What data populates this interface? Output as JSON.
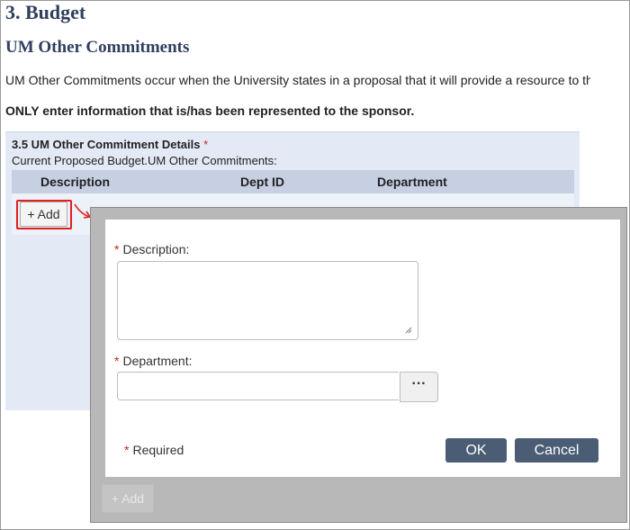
{
  "page": {
    "section_title": "3. Budget",
    "subsection_title": "UM Other Commitments",
    "intro_text": "UM Other Commitments occur when the University states in a proposal that it will provide a resource to th",
    "note_bold": "ONLY enter information that is/has been represented to the sponsor."
  },
  "panel": {
    "title": "3.5 UM Other Commitment Details",
    "required_mark": "*",
    "subtitle": "Current Proposed Budget.UM Other Commitments:",
    "columns": [
      "Description",
      "Dept ID",
      "Department"
    ],
    "add_label": "+ Add"
  },
  "dialog": {
    "description_label": "Description:",
    "department_label": "Department:",
    "required_mark": "*",
    "browse_label": "···",
    "required_note": "Required",
    "ok_label": "OK",
    "cancel_label": "Cancel",
    "description_value": "",
    "department_value": ""
  },
  "modal": {
    "bottom_add_label": "+ Add"
  },
  "colors": {
    "heading": "#2f3f5f",
    "panel_bg": "#e3e9f5",
    "column_header_bg": "#c6d0e2",
    "button_bg": "#4a5d74",
    "highlight": "#e02020",
    "required": "#cc2222"
  }
}
